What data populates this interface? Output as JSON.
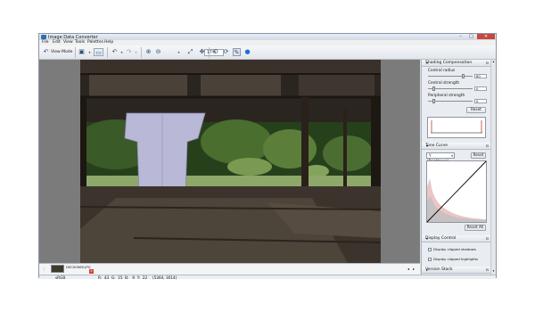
{
  "window": {
    "title": "Image Data Converter"
  },
  "window_buttons": {
    "minimize": "–",
    "maximize": "□",
    "close": "✕"
  },
  "menu": [
    "File",
    "Edit",
    "View",
    "Tools",
    "Palettes",
    "Help"
  ],
  "toolbar": {
    "view_mode_label": "View Mode",
    "zoom_value": "17%"
  },
  "panels": {
    "shading": {
      "title": "Shading Compensation",
      "central_radius_label": "Central radius",
      "central_radius_value": "80",
      "central_strength_label": "Central strength",
      "central_strength_value": "0",
      "peripheral_strength_label": "Peripheral strength",
      "peripheral_strength_value": "0",
      "reset_label": "Reset"
    },
    "tone_curve": {
      "title": "Tone Curve",
      "channel": "Y (Brightness)",
      "reset_label": "Reset",
      "reset_all_label": "Reset All"
    },
    "display_control": {
      "title": "Display Control",
      "shadows_label": "Display clipped shadows",
      "highlights_label": "Display clipped highlights"
    },
    "version_stack": {
      "title": "Version Stack"
    }
  },
  "thumbnail": {
    "filename": "DSC00965.JPG"
  },
  "status": {
    "color_space": "sRGB",
    "rgb_readout": "R:  43  G:  15  B:   9  Y:  22",
    "coords": "(5364, 3014)"
  },
  "icons": {
    "view_mode": "undo-arrow-icon",
    "save": "save-icon",
    "zoom_in": "zoom-in-icon",
    "zoom_out": "zoom-out-icon"
  }
}
